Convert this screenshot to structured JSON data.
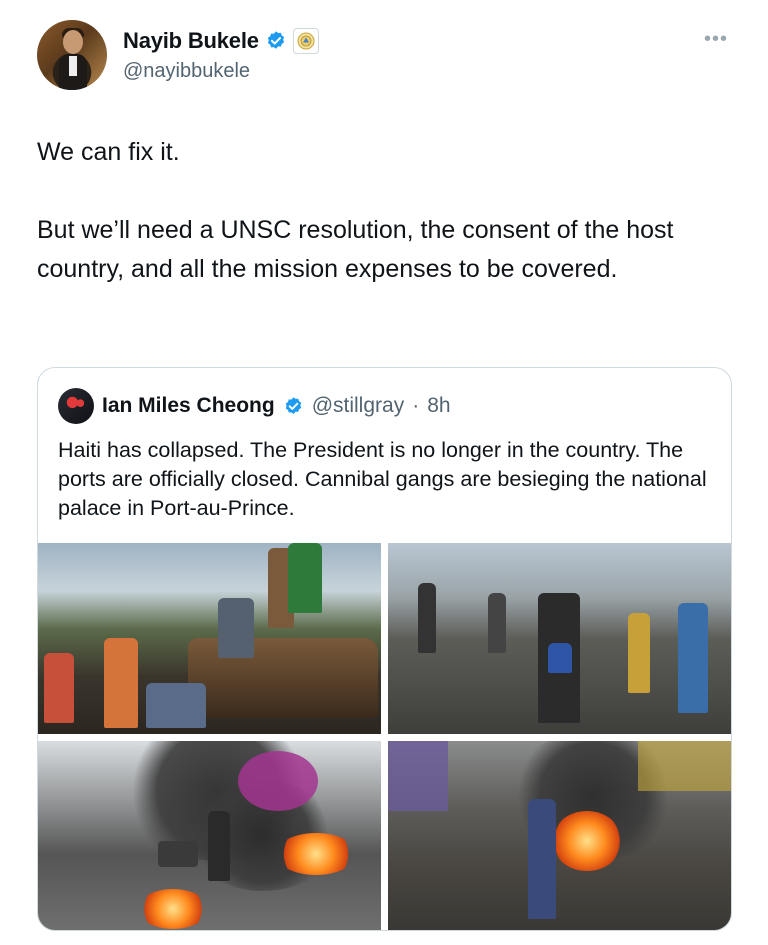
{
  "author": {
    "name": "Nayib Bukele",
    "handle": "@nayibbukele",
    "more_label": "•••"
  },
  "tweet": {
    "paragraphs": [
      "We can fix it.",
      "But we’ll need a UNSC resolution, the consent of the host country, and all the mission expenses to be covered."
    ]
  },
  "quoted": {
    "name": "Ian Miles Cheong",
    "handle": "@stillgray",
    "separator": "·",
    "time": "8h",
    "text": "Haiti has collapsed. The President is no longer in the country. The ports are officially closed. Cannibal gangs are besieging the national palace in Port-au-Prince."
  },
  "colors": {
    "verified_blue": "#1d9bf0",
    "text": "#0f1419",
    "secondary": "#536471",
    "border": "#cfd9de"
  },
  "icons": {
    "verified": "verified-badge-icon",
    "affiliation": "government-seal-icon",
    "more": "more-horizontal-icon"
  }
}
